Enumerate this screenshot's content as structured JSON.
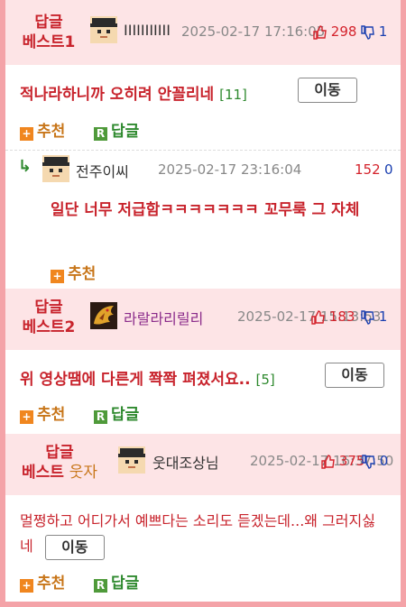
{
  "best1": {
    "rank_line1": "답글",
    "rank_line2": "베스트1",
    "nickname": "IIIIIIIIIII",
    "date": "2025-02-17 17:16:05",
    "likes": "298",
    "dislikes": "1",
    "title": "적나라하니까 오히려 안꼴리네",
    "count": "[11]",
    "move_label": "이동",
    "recommend_label": "추천",
    "reply_label": "답글"
  },
  "sub_reply": {
    "nickname": "전주이씨",
    "date": "2025-02-17 23:16:04",
    "likes": "152",
    "dislikes": "0",
    "text": "일단 너무 저급함ㅋㅋㅋㅋㅋㅋㅋ 꼬무룩 그 자체",
    "recommend_label": "추천"
  },
  "best2": {
    "rank_line1": "답글",
    "rank_line2": "베스트2",
    "nickname": "라랄라리릴리",
    "date": "2025-02-17 15:13:53",
    "likes": "183",
    "dislikes": "1",
    "title": "위 영상땜에 다른게 쫙쫙 펴졌서요..",
    "count": "[5]",
    "move_label": "이동",
    "recommend_label": "추천",
    "reply_label": "답글"
  },
  "best3": {
    "rank_line1": "답글",
    "rank_line2": "베스트",
    "rank_extra": "웃자",
    "nickname": "웃대조상님",
    "date": "2025-02-17 16:37:50",
    "likes": "375",
    "dislikes": "0",
    "title": "멀쩡하고 어디가서 예쁘다는 소리도 듣겠는데...왜 그러지싫네",
    "move_label": "이동",
    "recommend_label": "추천",
    "reply_label": "답글"
  },
  "colors": {
    "accent": "#c8232c",
    "header_bg": "#fde4e6",
    "frame": "#f4a3a8",
    "green": "#2f8a2f",
    "orange": "#f0861f",
    "blue": "#1a3fb0"
  },
  "icons": {
    "avatar_pixel": "pixel-face-avatar-icon",
    "avatar_dragon": "gold-dragon-avatar-icon",
    "thumb_up": "thumb-up-icon",
    "thumb_down": "thumb-down-icon",
    "reply_arrow": "reply-arrow-icon"
  }
}
